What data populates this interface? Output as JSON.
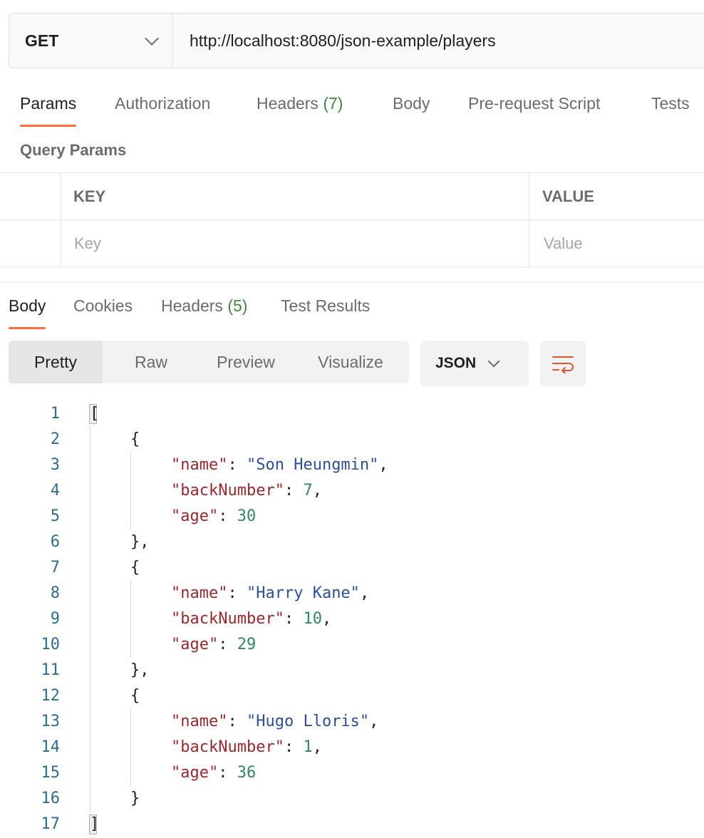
{
  "request": {
    "method": "GET",
    "url": "http://localhost:8080/json-example/players"
  },
  "request_tabs": [
    {
      "label": "Params",
      "count": ""
    },
    {
      "label": "Authorization",
      "count": ""
    },
    {
      "label": "Headers",
      "count": "(7)"
    },
    {
      "label": "Body",
      "count": ""
    },
    {
      "label": "Pre-request Script",
      "count": ""
    },
    {
      "label": "Tests",
      "count": ""
    }
  ],
  "query_params": {
    "title": "Query Params",
    "key_header": "KEY",
    "value_header": "VALUE",
    "key_placeholder": "Key",
    "value_placeholder": "Value"
  },
  "response_tabs": [
    {
      "label": "Body",
      "count": ""
    },
    {
      "label": "Cookies",
      "count": ""
    },
    {
      "label": "Headers",
      "count": "(5)"
    },
    {
      "label": "Test Results",
      "count": ""
    }
  ],
  "view_modes": [
    "Pretty",
    "Raw",
    "Preview",
    "Visualize"
  ],
  "format": "JSON",
  "icons": {
    "wrap": "wrap-lines-icon",
    "chevron": "chevron-down-icon"
  },
  "colors": {
    "accent": "#ff6c37",
    "count": "#3e8a3b",
    "json_key": "#a1262b",
    "json_string": "#2a4e9c",
    "json_number": "#2f8a5e",
    "line_number": "#2b6e8f"
  },
  "response_lines": [
    {
      "n": "1",
      "indent": 0,
      "parts": [
        {
          "t": "[",
          "c": "p"
        }
      ]
    },
    {
      "n": "2",
      "indent": 1,
      "parts": [
        {
          "t": "{",
          "c": "p"
        }
      ]
    },
    {
      "n": "3",
      "indent": 2,
      "parts": [
        {
          "t": "\"name\"",
          "c": "key"
        },
        {
          "t": ": ",
          "c": "p"
        },
        {
          "t": "\"Son Heungmin\"",
          "c": "str"
        },
        {
          "t": ",",
          "c": "p"
        }
      ]
    },
    {
      "n": "4",
      "indent": 2,
      "parts": [
        {
          "t": "\"backNumber\"",
          "c": "key"
        },
        {
          "t": ": ",
          "c": "p"
        },
        {
          "t": "7",
          "c": "num"
        },
        {
          "t": ",",
          "c": "p"
        }
      ]
    },
    {
      "n": "5",
      "indent": 2,
      "parts": [
        {
          "t": "\"age\"",
          "c": "key"
        },
        {
          "t": ": ",
          "c": "p"
        },
        {
          "t": "30",
          "c": "num"
        }
      ]
    },
    {
      "n": "6",
      "indent": 1,
      "parts": [
        {
          "t": "},",
          "c": "p"
        }
      ]
    },
    {
      "n": "7",
      "indent": 1,
      "parts": [
        {
          "t": "{",
          "c": "p"
        }
      ]
    },
    {
      "n": "8",
      "indent": 2,
      "parts": [
        {
          "t": "\"name\"",
          "c": "key"
        },
        {
          "t": ": ",
          "c": "p"
        },
        {
          "t": "\"Harry Kane\"",
          "c": "str"
        },
        {
          "t": ",",
          "c": "p"
        }
      ]
    },
    {
      "n": "9",
      "indent": 2,
      "parts": [
        {
          "t": "\"backNumber\"",
          "c": "key"
        },
        {
          "t": ": ",
          "c": "p"
        },
        {
          "t": "10",
          "c": "num"
        },
        {
          "t": ",",
          "c": "p"
        }
      ]
    },
    {
      "n": "10",
      "indent": 2,
      "parts": [
        {
          "t": "\"age\"",
          "c": "key"
        },
        {
          "t": ": ",
          "c": "p"
        },
        {
          "t": "29",
          "c": "num"
        }
      ]
    },
    {
      "n": "11",
      "indent": 1,
      "parts": [
        {
          "t": "},",
          "c": "p"
        }
      ]
    },
    {
      "n": "12",
      "indent": 1,
      "parts": [
        {
          "t": "{",
          "c": "p"
        }
      ]
    },
    {
      "n": "13",
      "indent": 2,
      "parts": [
        {
          "t": "\"name\"",
          "c": "key"
        },
        {
          "t": ": ",
          "c": "p"
        },
        {
          "t": "\"Hugo Lloris\"",
          "c": "str"
        },
        {
          "t": ",",
          "c": "p"
        }
      ]
    },
    {
      "n": "14",
      "indent": 2,
      "parts": [
        {
          "t": "\"backNumber\"",
          "c": "key"
        },
        {
          "t": ": ",
          "c": "p"
        },
        {
          "t": "1",
          "c": "num"
        },
        {
          "t": ",",
          "c": "p"
        }
      ]
    },
    {
      "n": "15",
      "indent": 2,
      "parts": [
        {
          "t": "\"age\"",
          "c": "key"
        },
        {
          "t": ": ",
          "c": "p"
        },
        {
          "t": "36",
          "c": "num"
        }
      ]
    },
    {
      "n": "16",
      "indent": 1,
      "parts": [
        {
          "t": "}",
          "c": "p"
        }
      ]
    },
    {
      "n": "17",
      "indent": 0,
      "parts": [
        {
          "t": "]",
          "c": "p"
        }
      ]
    }
  ]
}
